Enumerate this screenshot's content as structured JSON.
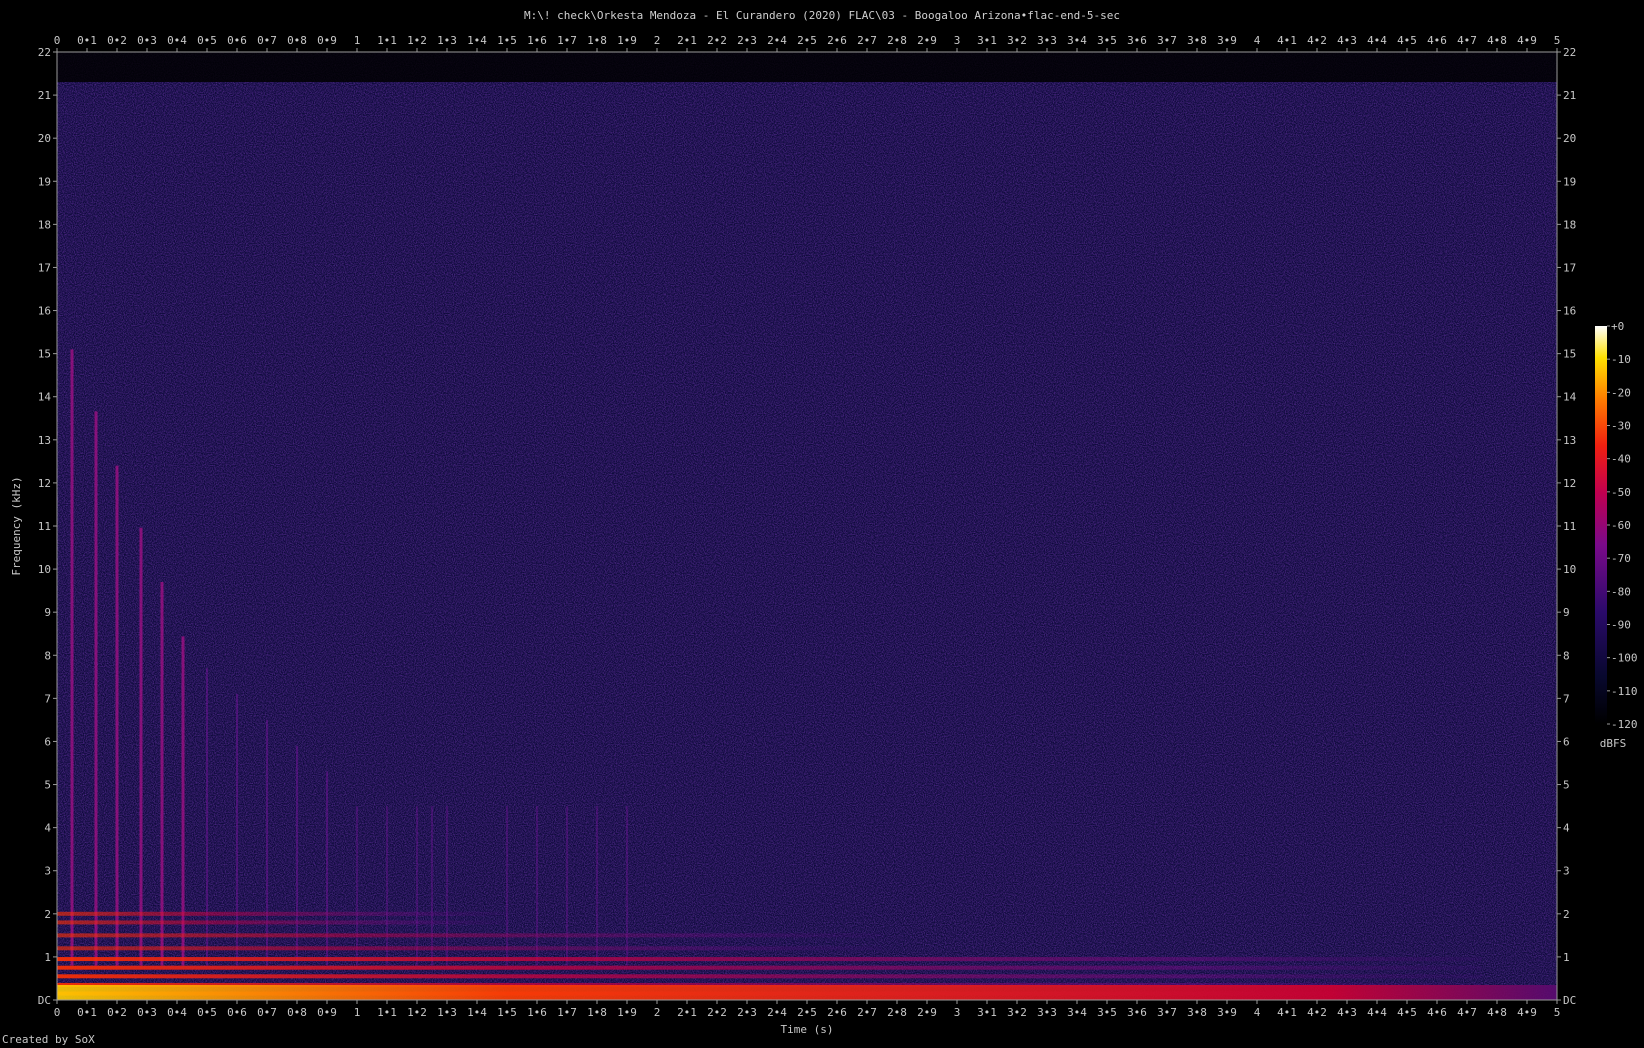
{
  "chart_data": {
    "type": "heatmap",
    "title": "M:\\! check\\Orkesta Mendoza - El Curandero (2020) FLAC\\03 - Boogaloo Arizona•flac-end-5-sec",
    "xlabel": "Time (s)",
    "ylabel": "Frequency (kHz)",
    "x_range": [
      0,
      5
    ],
    "y_range": [
      0,
      22
    ],
    "x_ticks": [
      "0",
      "0•1",
      "0•2",
      "0•3",
      "0•4",
      "0•5",
      "0•6",
      "0•7",
      "0•8",
      "0•9",
      "1",
      "1•1",
      "1•2",
      "1•3",
      "1•4",
      "1•5",
      "1•6",
      "1•7",
      "1•8",
      "1•9",
      "2",
      "2•1",
      "2•2",
      "2•3",
      "2•4",
      "2•5",
      "2•6",
      "2•7",
      "2•8",
      "2•9",
      "3",
      "3•1",
      "3•2",
      "3•3",
      "3•4",
      "3•5",
      "3•6",
      "3•7",
      "3•8",
      "3•9",
      "4",
      "4•1",
      "4•2",
      "4•3",
      "4•4",
      "4•5",
      "4•6",
      "4•7",
      "4•8",
      "4•9",
      "5"
    ],
    "y_ticks": [
      "DC",
      "1",
      "2",
      "3",
      "4",
      "5",
      "6",
      "7",
      "8",
      "9",
      "10",
      "11",
      "12",
      "13",
      "14",
      "15",
      "16",
      "17",
      "18",
      "19",
      "20",
      "21",
      "22"
    ],
    "colorbar": {
      "label": "dBFS",
      "range": [
        -120,
        0
      ],
      "ticks": [
        "+0",
        "-10",
        "-20",
        "-30",
        "-40",
        "-50",
        "-60",
        "-70",
        "-80",
        "-90",
        "-100",
        "-110",
        "-120"
      ]
    },
    "spectral_bands_khz": [
      0.15,
      0.35,
      0.55,
      0.75,
      0.95,
      1.2,
      1.5,
      1.8,
      2.0
    ],
    "transients_s": [
      0.05,
      0.13,
      0.2,
      0.28,
      0.35,
      0.42,
      0.5,
      0.6,
      0.7,
      0.8,
      0.9,
      1.0,
      1.1,
      1.2,
      1.25,
      1.3,
      1.5,
      1.6,
      1.7,
      1.8,
      1.9
    ],
    "noise_ceiling_khz": 21.5
  },
  "footer": "Created by SoX"
}
